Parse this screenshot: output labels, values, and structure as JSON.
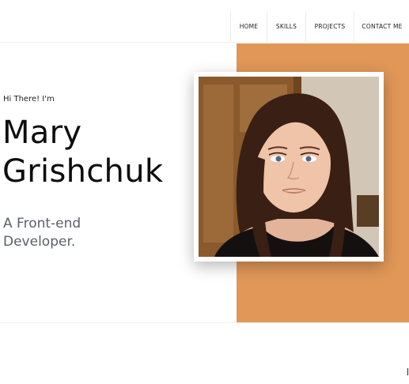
{
  "nav": {
    "items": [
      {
        "label": "HOME"
      },
      {
        "label": "SKILLS"
      },
      {
        "label": "PROJECTS"
      },
      {
        "label": "CONTACT ME"
      }
    ]
  },
  "hero": {
    "greeting": "Hi There! I'm",
    "name_line1": "Mary",
    "name_line2": "Grishchuk",
    "role_line1": "A Front-end",
    "role_line2": "Developer.",
    "photo_icon": "portrait-photo",
    "accent_color": "#E09758"
  }
}
